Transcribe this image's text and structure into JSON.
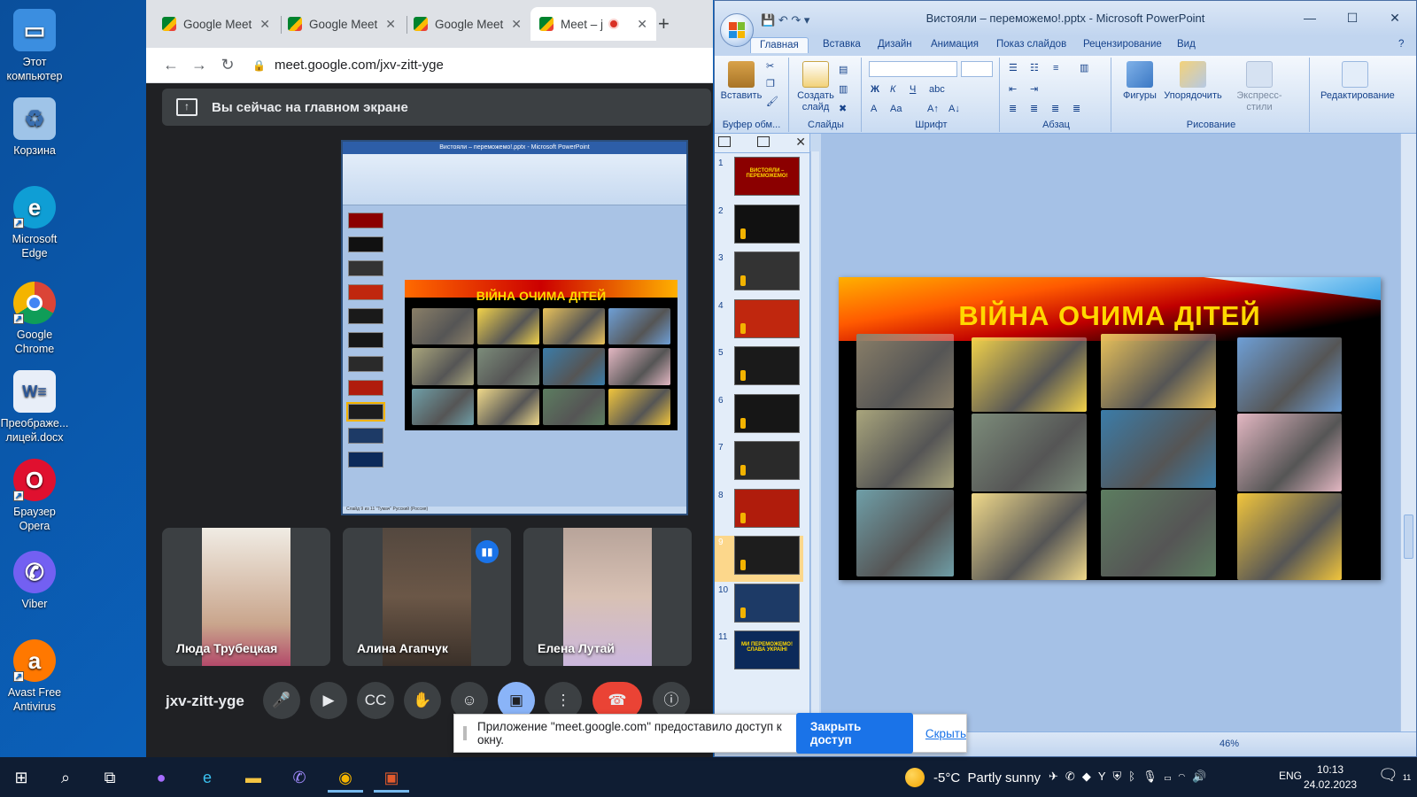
{
  "desktop": {
    "icons": [
      {
        "label": "Этот компьютер",
        "icon": "computer-icon",
        "color": "#3b8ee0"
      },
      {
        "label": "Корзина",
        "icon": "recycle-bin-icon",
        "color": "#9fc4e8"
      },
      {
        "label": "Microsoft Edge",
        "icon": "edge-icon",
        "color": "#0f9ed5"
      },
      {
        "label": "Google Chrome",
        "icon": "chrome-icon",
        "color": "#db4437"
      },
      {
        "label": "Преображе... лицей.docx",
        "icon": "word-doc-icon",
        "color": "#e8eef8"
      },
      {
        "label": "Браузер Opera",
        "icon": "opera-icon",
        "color": "#e0102f"
      },
      {
        "label": "Viber",
        "icon": "viber-icon",
        "color": "#7360f2"
      },
      {
        "label": "Avast Free Antivirus",
        "icon": "avast-icon",
        "color": "#ff7800"
      }
    ]
  },
  "chrome": {
    "tabs": [
      {
        "label": "Google Meet"
      },
      {
        "label": "Google Meet"
      },
      {
        "label": "Google Meet"
      },
      {
        "label": "Meet – j"
      }
    ],
    "url": "meet.google.com/jxv-zitt-yge"
  },
  "meet": {
    "banner": "Вы сейчас на главном экране",
    "participants": [
      {
        "name": "Люда Трубецкая",
        "color": "#c9a58c"
      },
      {
        "name": "Алина Агапчук",
        "color": "#6b5747"
      },
      {
        "name": "Елена Лутай",
        "color": "#d8c1b4"
      }
    ],
    "meeting_code": "jxv-zitt-yge",
    "speaking_icon": "audio-wave-icon"
  },
  "ppt": {
    "title": "Вистояли – переможемо!.pptx - Microsoft PowerPoint",
    "mini_title": "Вистояли – переможемо!.pptx - Microsoft PowerPoint",
    "ribbon_tabs": [
      "Главная",
      "Вставка",
      "Дизайн",
      "Анимация",
      "Показ слайдов",
      "Рецензирование",
      "Вид"
    ],
    "groups": {
      "clipboard": "Буфер обм...",
      "slides": "Слайды",
      "font": "Шрифт",
      "paragraph": "Абзац",
      "drawing": "Рисование"
    },
    "buttons": {
      "paste": "Вставить",
      "new_slide": "Создать слайд",
      "shapes": "Фигуры",
      "arrange": "Упорядочить",
      "quick_styles": "Экспресс-стили",
      "editing": "Редактирование"
    },
    "thumbnails": [
      "1",
      "2",
      "3",
      "4",
      "5",
      "6",
      "7",
      "8",
      "9",
      "10",
      "11"
    ],
    "thumb_colors": [
      "#8b0000",
      "#111111",
      "#333333",
      "#c0270e",
      "#1a1a1a",
      "#161616",
      "#2a2a2a",
      "#b01c0c",
      "#1d1d1d",
      "#1d3a66",
      "#0c2a5a"
    ],
    "thumb1_text": "ВИСТОЯЛИ – ПЕРЕМОЖЕМО!",
    "thumb11_text": "МИ ПЕРЕМОЖЕМО! СЛАВА УКРАЇНІ",
    "selected_slide": 9,
    "slide_title": "ВІЙНА ОЧИМА ДІТЕЙ",
    "drawing_colors": [
      "#8a7f68",
      "#f2d24a",
      "#e9c25a",
      "#6e9fd6",
      "#a9a57c",
      "#7c8c7a",
      "#3b7ca8",
      "#e3b7c2",
      "#6f9fa8",
      "#f0d98a",
      "#5c7d60",
      "#f1c53c"
    ],
    "zoom": "46%",
    "mini_status": "Слайд 9 из 11   \"Тумач\"   Русский (Россия)"
  },
  "share_notice": {
    "text": "Приложение \"meet.google.com\" предоставило доступ к окну.",
    "stop": "Закрыть доступ",
    "hide": "Скрыть"
  },
  "taskbar": {
    "weather_temp": "-5°C",
    "weather_text": "Partly sunny",
    "lang": "ENG",
    "time": "10:13",
    "date": "24.02.2023",
    "notifications": "11"
  }
}
